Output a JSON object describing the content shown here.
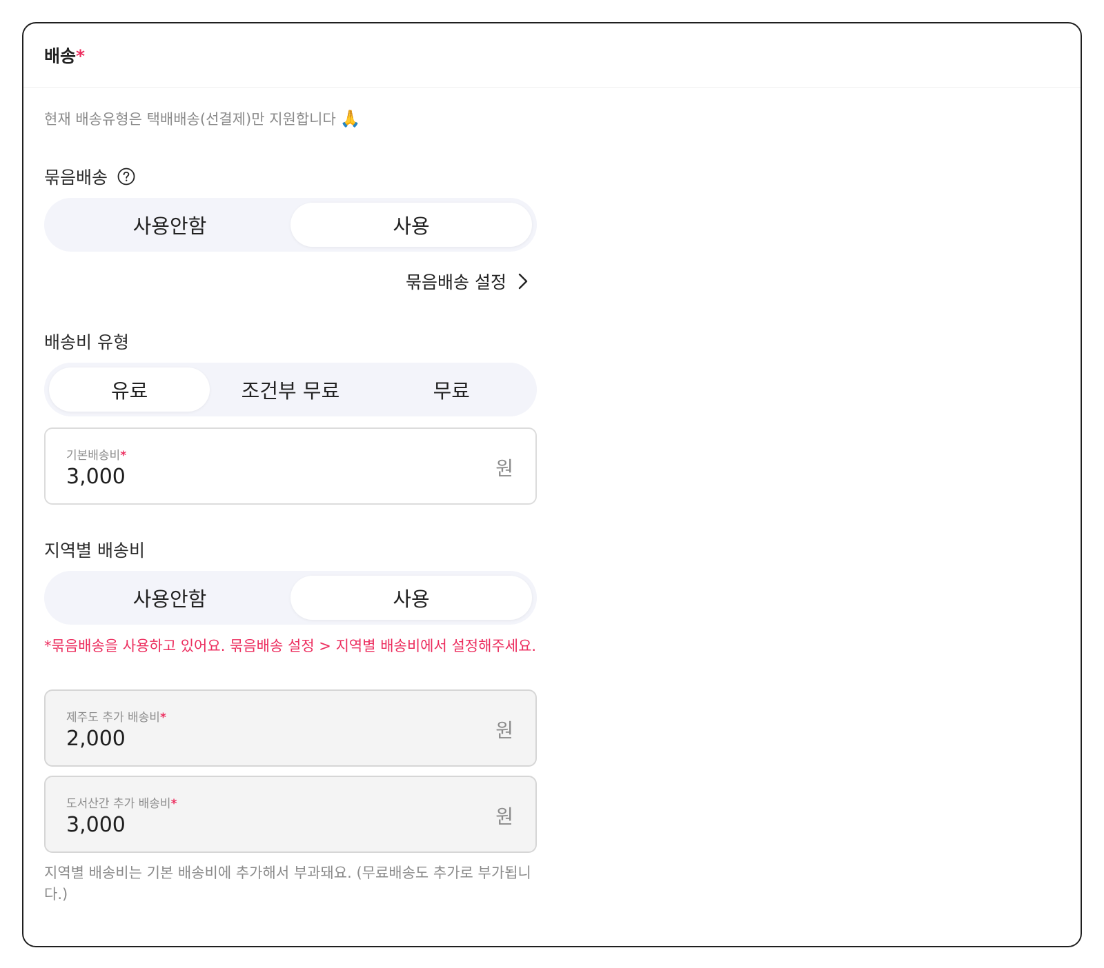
{
  "section": {
    "title": "배송",
    "required_mark": "*",
    "notice": "현재 배송유형은 택배배송(선결제)만 지원합니다",
    "notice_emoji": "🙏"
  },
  "bundle": {
    "label": "묶음배송",
    "help_icon": "question-circle-icon",
    "options": [
      "사용안함",
      "사용"
    ],
    "selected": "사용",
    "settings_link": "묶음배송 설정"
  },
  "fee_type": {
    "label": "배송비 유형",
    "options": [
      "유료",
      "조건부 무료",
      "무료"
    ],
    "selected": "유료"
  },
  "base_fee": {
    "label": "기본배송비",
    "required_mark": "*",
    "value": "3,000",
    "unit": "원"
  },
  "regional": {
    "label": "지역별 배송비",
    "options": [
      "사용안함",
      "사용"
    ],
    "selected": "사용",
    "warning": "*묶음배송을 사용하고 있어요. 묶음배송 설정 > 지역별 배송비에서 설정해주세요.",
    "jeju": {
      "label": "제주도 추가 배송비",
      "required_mark": "*",
      "value": "2,000",
      "unit": "원"
    },
    "island": {
      "label": "도서산간 추가 배송비",
      "required_mark": "*",
      "value": "3,000",
      "unit": "원"
    },
    "footnote": "지역별 배송비는 기본 배송비에 추가해서 부과돼요. (무료배송도 추가로 부가됩니다.)"
  },
  "colors": {
    "accent_required": "#ec2d5e",
    "segment_bg": "#f3f4fa",
    "muted_text": "#8a8a8a"
  }
}
